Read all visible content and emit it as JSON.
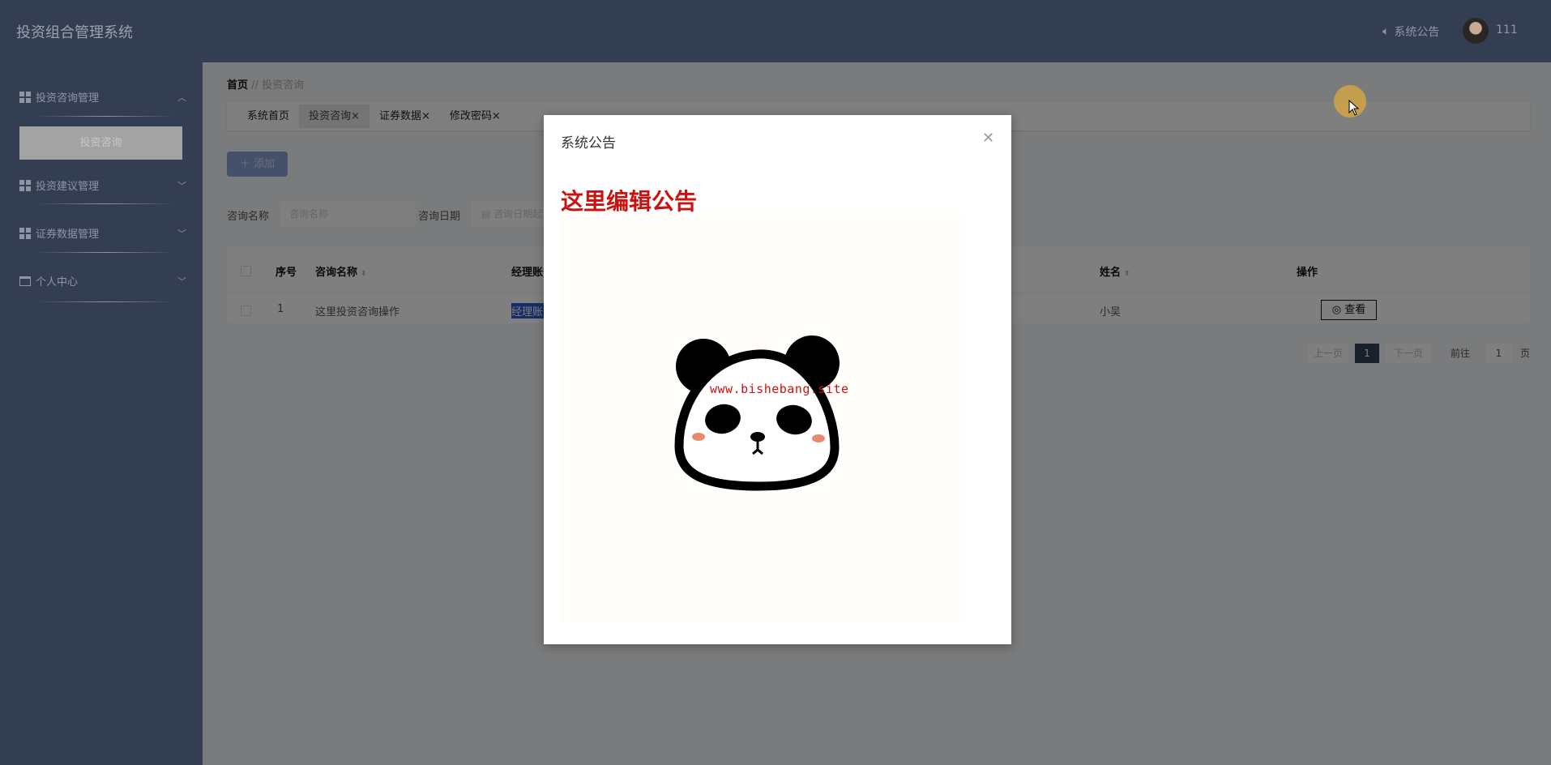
{
  "header": {
    "app_title": "投资组合管理系统",
    "notice_label": "系统公告",
    "username": "111",
    "icons": [
      "speaker-icon",
      "avatar"
    ]
  },
  "sidebar": {
    "items": [
      {
        "label": "投资咨询管理",
        "icon": "grid-icon",
        "expanded": true,
        "children": [
          {
            "label": "投资咨询"
          }
        ]
      },
      {
        "label": "投资建议管理",
        "icon": "grid-icon"
      },
      {
        "label": "证券数据管理",
        "icon": "grid-icon"
      },
      {
        "label": "个人中心",
        "icon": "card-icon"
      }
    ]
  },
  "breadcrumb": {
    "home": "首页",
    "separator": "//",
    "current": "投资咨询"
  },
  "tabs": [
    {
      "label": "系统首页"
    },
    {
      "label": "投资咨询",
      "active": true
    },
    {
      "label": "证券数据"
    },
    {
      "label": "修改密码"
    }
  ],
  "toolbar": {
    "add_label": "添加"
  },
  "search": {
    "name_label": "咨询名称",
    "name_placeholder": "咨询名称",
    "date_label": "咨询日期",
    "date_placeholder": "咨询日期起"
  },
  "table": {
    "headers": [
      "序号",
      "咨询名称",
      "经理账号",
      "姓名",
      "操作"
    ],
    "rows": [
      {
        "index": "1",
        "name": "这里投资咨询操作",
        "manager": "经理账号",
        "person": "小吴",
        "action": "查看"
      }
    ]
  },
  "pagination": {
    "prev": "上一页",
    "current": "1",
    "next": "下一页",
    "goto_label": "前往",
    "goto_value": "1",
    "page_suffix": "页"
  },
  "modal": {
    "title": "系统公告",
    "heading": "这里编辑公告",
    "watermark": "www.bishebang.site",
    "heading_color": "#cc1111"
  }
}
